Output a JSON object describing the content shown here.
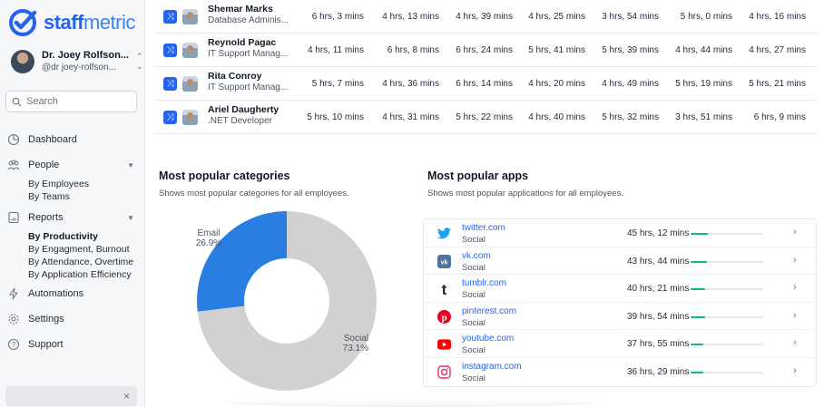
{
  "app": {
    "logo_bold": "staff",
    "logo_light": "metric"
  },
  "user": {
    "name": "Dr. Joey Rolfson...",
    "handle": "@dr joey-rolfson..."
  },
  "search": {
    "placeholder": "Search"
  },
  "nav": {
    "dashboard": "Dashboard",
    "people": "People",
    "people_sub": [
      "By Employees",
      "By Teams"
    ],
    "reports": "Reports",
    "reports_sub": [
      "By Productivity",
      "By Engagment, Burnout",
      "By Attendance, Overtime",
      "By Application Efficiency"
    ],
    "automations": "Automations",
    "settings": "Settings",
    "support": "Support"
  },
  "employees": [
    {
      "name": "Shemar Marks",
      "role": "Database Adminis...",
      "times": [
        "6 hrs, 3 mins",
        "4 hrs, 13 mins",
        "4 hrs, 39 mins",
        "4 hrs, 25 mins",
        "3 hrs, 54 mins",
        "5 hrs, 0 mins",
        "4 hrs, 16 mins"
      ]
    },
    {
      "name": "Reynold Pagac",
      "role": "IT Support Manag...",
      "times": [
        "4 hrs, 11 mins",
        "6 hrs, 8 mins",
        "6 hrs, 24 mins",
        "5 hrs, 41 mins",
        "5 hrs, 39 mins",
        "4 hrs, 44 mins",
        "4 hrs, 27 mins"
      ]
    },
    {
      "name": "Rita Conroy",
      "role": "IT Support Manag...",
      "times": [
        "5 hrs, 7 mins",
        "4 hrs, 36 mins",
        "6 hrs, 14 mins",
        "4 hrs, 20 mins",
        "4 hrs, 49 mins",
        "5 hrs, 19 mins",
        "5 hrs, 21 mins"
      ]
    },
    {
      "name": "Ariel Daugherty",
      "role": ".NET Developer",
      "times": [
        "5 hrs, 10 mins",
        "4 hrs, 31 mins",
        "5 hrs, 22 mins",
        "4 hrs, 40 mins",
        "5 hrs, 32 mins",
        "3 hrs, 51 mins",
        "6 hrs, 9 mins"
      ]
    }
  ],
  "categories": {
    "title": "Most popular categories",
    "subtitle": "Shows most popular categories for all employees.",
    "colors": {
      "Email": "#2a7de1",
      "Social": "#d1d1d1"
    }
  },
  "chart_data": {
    "type": "pie",
    "donut": true,
    "slices": [
      {
        "label": "Email",
        "value": 26.9,
        "display": "26.9%"
      },
      {
        "label": "Social",
        "value": 73.1,
        "display": "73.1%"
      }
    ]
  },
  "apps": {
    "title": "Most popular apps",
    "subtitle": "Shows most popular applications for all employees.",
    "items": [
      {
        "name": "twitter.com",
        "category": "Social",
        "time": "45 hrs, 12 mins",
        "share": 0.24,
        "icon": "twitter-icon"
      },
      {
        "name": "vk.com",
        "category": "Social",
        "time": "43 hrs, 44 mins",
        "share": 0.22,
        "icon": "vk-icon"
      },
      {
        "name": "tumblr.com",
        "category": "Social",
        "time": "40 hrs, 21 mins",
        "share": 0.2,
        "icon": "tumblr-icon"
      },
      {
        "name": "pinterest.com",
        "category": "Social",
        "time": "39 hrs, 54 mins",
        "share": 0.2,
        "icon": "pinterest-icon"
      },
      {
        "name": "youtube.com",
        "category": "Social",
        "time": "37 hrs, 55 mins",
        "share": 0.18,
        "icon": "youtube-icon"
      },
      {
        "name": "instagram.com",
        "category": "Social",
        "time": "36 hrs, 29 mins",
        "share": 0.18,
        "icon": "instagram-icon"
      }
    ]
  }
}
